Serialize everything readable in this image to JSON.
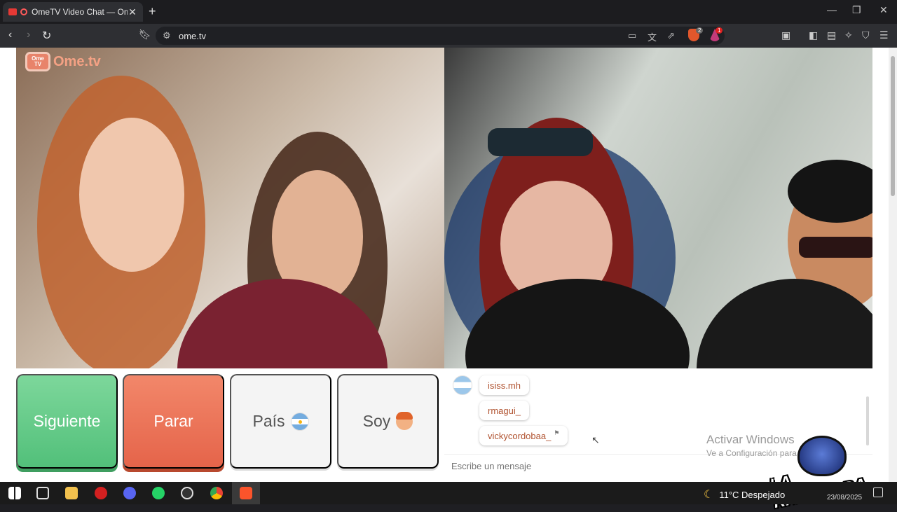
{
  "browser": {
    "tab_title": "OmeTV Video Chat — Omegl",
    "url": "ome.tv",
    "extension_badges": [
      "2",
      "1"
    ]
  },
  "logo": {
    "icon_text": "Ome TV",
    "text": "Ome.tv"
  },
  "buttons": {
    "next": "Siguiente",
    "stop": "Parar",
    "country": "País",
    "gender": "Soy"
  },
  "chat": {
    "messages": [
      "isiss.mh",
      "rmagui_",
      "vickycordobaa_"
    ],
    "placeholder": "Escribe un mensaje"
  },
  "watermark": {
    "line1": "Activar Windows",
    "line2": "Ve a Configuración para"
  },
  "overlay": {
    "channel_name": "LA RANCHADA"
  },
  "taskbar": {
    "weather": "11°C  Despejado",
    "date": "23/08/2025"
  },
  "colors": {
    "next_green": "#5ec985",
    "stop_red": "#ea6d52",
    "username": "#b0522f"
  }
}
